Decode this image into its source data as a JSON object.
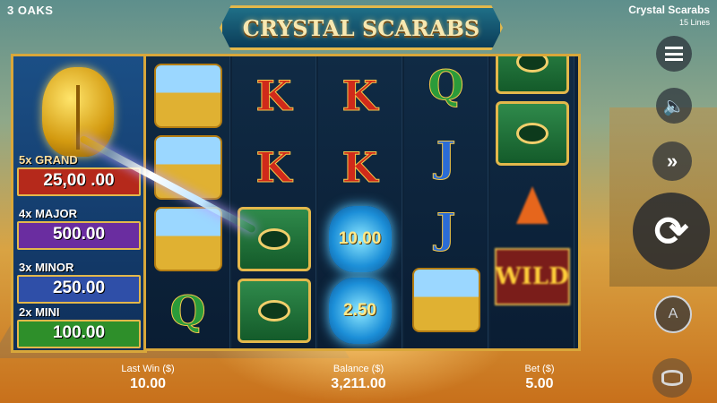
{
  "brand": "3 OAKS",
  "game": {
    "title": "Crystal Scarabs",
    "lines": "15 Lines"
  },
  "logo": "CRYSTAL SCARABS",
  "jackpots": [
    {
      "label": "5x GRAND",
      "value": "25,00  .00"
    },
    {
      "label": "4x MAJOR",
      "value": "500.00"
    },
    {
      "label": "3x MINOR",
      "value": "250.00"
    },
    {
      "label": "2x MINI",
      "value": "100.00"
    }
  ],
  "reels": [
    [
      "crown",
      "crown",
      "crown",
      "Q"
    ],
    [
      "K",
      "K",
      "eye",
      "eye"
    ],
    [
      "K",
      "K",
      "scarab:10.00",
      "scarab:2.50"
    ],
    [
      "Q",
      "J",
      "J",
      "crown"
    ],
    [
      "eye",
      "eye",
      "arrow",
      "WILD"
    ]
  ],
  "scarab_values": {
    "r2c2": "10.00",
    "r2c3": "2.50"
  },
  "wild_text": "WILD",
  "footer": {
    "last_win_label": "Last Win ($)",
    "last_win": "10.00",
    "balance_label": "Balance ($)",
    "balance": "3,211.00",
    "bet_label": "Bet ($)",
    "bet": "5.00"
  },
  "icons": [
    "menu-icon",
    "sound-icon",
    "turbo-icon",
    "spin-icon",
    "autoplay-icon",
    "coins-icon"
  ]
}
